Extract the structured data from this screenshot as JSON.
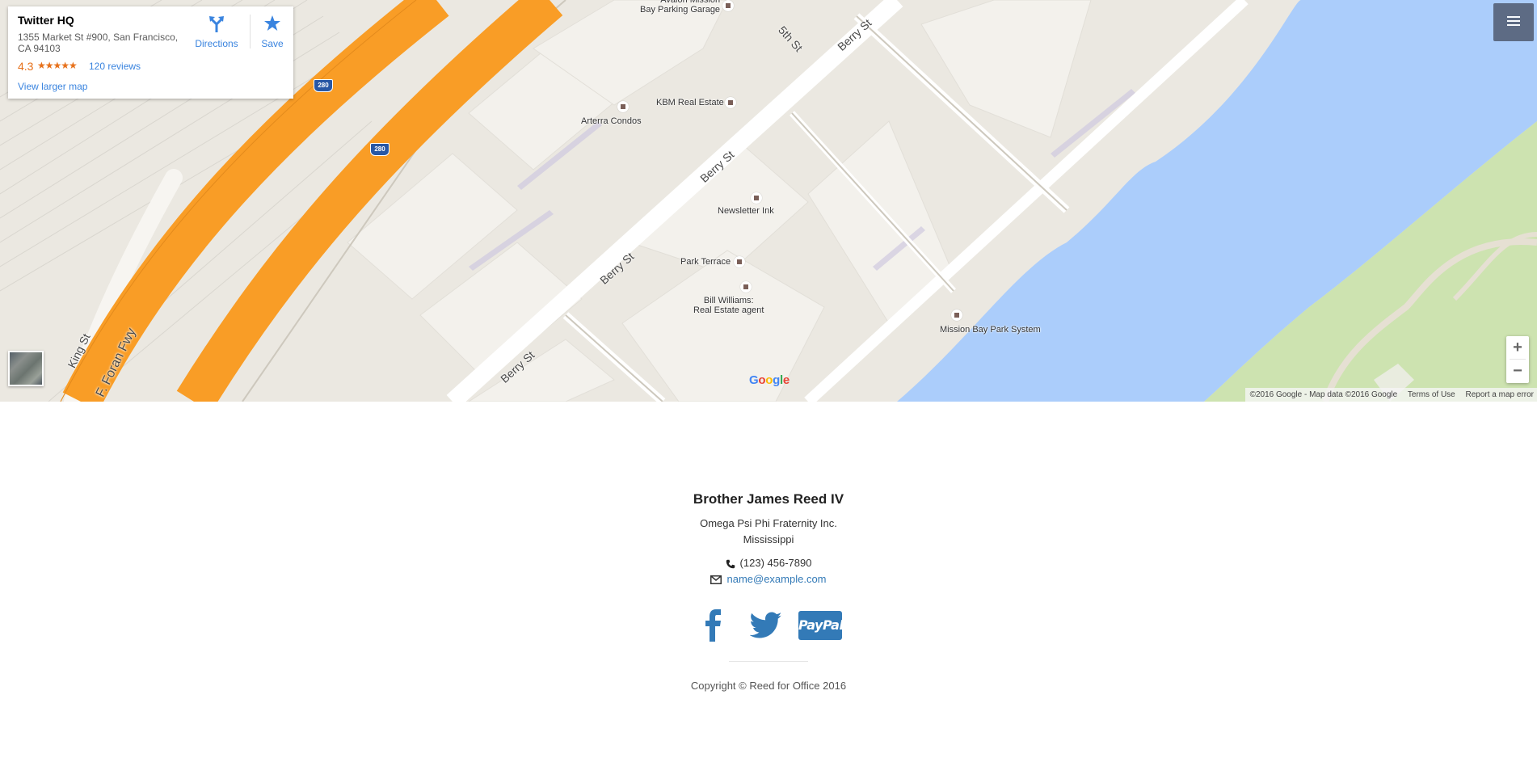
{
  "map": {
    "card": {
      "name": "Twitter HQ",
      "address": "1355 Market St #900, San Francisco, CA 94103",
      "rating": "4.3",
      "stars": "★★★★★",
      "reviews": "120 reviews",
      "directions_label": "Directions",
      "save_label": "Save",
      "larger_map": "View larger map"
    },
    "streets": {
      "fifth": "5th St",
      "berry_1": "Berry St",
      "berry_2": "Berry St",
      "berry_3": "Berry St",
      "berry_4": "Berry St",
      "king": "King St",
      "foran": "F. Foran Fwy"
    },
    "shields": {
      "i280_a": "280",
      "i280_b": "280"
    },
    "places": {
      "parking": "Avalon Mission\nBay Parking Garage",
      "kbm": "KBM Real Estate",
      "arterra": "Arterra Condos",
      "newsletter": "Newsletter Ink",
      "park_terrace": "Park Terrace",
      "bill_williams": "Bill Williams:\nReal Estate agent",
      "mission_bay": "Mission Bay Park System"
    },
    "logo": "Google",
    "attribution": {
      "data": "©2016 Google - Map data ©2016 Google",
      "terms": "Terms of Use",
      "report": "Report a map error"
    },
    "zoom_in": "+",
    "zoom_out": "−",
    "colors": {
      "land": "#ebe8e1",
      "freeway": "#f99d26",
      "water": "#abcdfb",
      "park": "#cde3b0",
      "block": "#f3f1ec"
    }
  },
  "footer": {
    "name": "Brother James Reed IV",
    "organization": "Omega Psi Phi Fraternity Inc.",
    "state": "Mississippi",
    "phone": "(123) 456-7890",
    "email": "name@example.com",
    "social": {
      "facebook": "facebook-icon",
      "twitter": "twitter-icon",
      "paypal": "PayPal"
    },
    "copyright": "Copyright © Reed for Office 2016",
    "link_color": "#337ab7"
  }
}
